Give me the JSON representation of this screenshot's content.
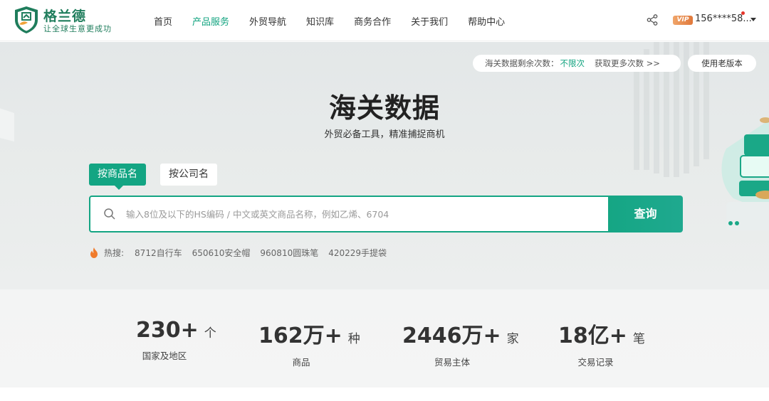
{
  "header": {
    "logo_name": "格兰德",
    "logo_slogan": "让全球生意更成功",
    "nav": [
      {
        "label": "首页",
        "active": false
      },
      {
        "label": "产品服务",
        "active": true
      },
      {
        "label": "外贸导航",
        "active": false
      },
      {
        "label": "知识库",
        "active": false
      },
      {
        "label": "商务合作",
        "active": false
      },
      {
        "label": "关于我们",
        "active": false
      },
      {
        "label": "帮助中心",
        "active": false
      }
    ],
    "vip_badge": "VIP",
    "user_phone": "156****58...",
    "share_icon": "share-icon",
    "dropdown_icon": "caret-down-icon"
  },
  "quota": {
    "label": "海关数据剩余次数：",
    "value": "不限次",
    "more_link": "获取更多次数 >>"
  },
  "old_version_label": "使用老版本",
  "hero": {
    "title": "海关数据",
    "subtitle": "外贸必备工具，精准捕捉商机"
  },
  "tabs": {
    "by_product": "按商品名",
    "by_company": "按公司名"
  },
  "search": {
    "value": "",
    "placeholder": "输入8位及以下的HS编码 / 中文或英文商品名称，例如乙烯、6704",
    "button_label": "查询"
  },
  "hot": {
    "label": "热搜:",
    "items": [
      "8712自行车",
      "650610安全帽",
      "960810圆珠笔",
      "420229手提袋"
    ]
  },
  "stats": [
    {
      "number": "230+",
      "unit": "个",
      "label": "国家及地区"
    },
    {
      "number": "162万+",
      "unit": "种",
      "label": "商品"
    },
    {
      "number": "2446万+",
      "unit": "家",
      "label": "贸易主体"
    },
    {
      "number": "18亿+",
      "unit": "笔",
      "label": "交易记录"
    }
  ],
  "colors": {
    "brand_green": "#13a583",
    "logo_green": "#1f7d5c",
    "vip_orange": "#e0783a",
    "notice_red": "#e5352b"
  }
}
